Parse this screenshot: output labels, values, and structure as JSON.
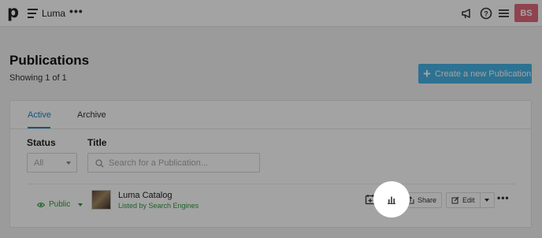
{
  "topbar": {
    "logo": "p",
    "app_name": "Luma",
    "more": "•••",
    "avatar_initials": "BS",
    "avatar_color": "#e06a7a"
  },
  "header": {
    "title": "Publications",
    "showing": "Showing 1 of 1",
    "create_button": "Create a new Publication",
    "create_button_icon": "+",
    "accent_color": "#47b2e4"
  },
  "tabs": [
    {
      "label": "Active",
      "selected": true
    },
    {
      "label": "Archive",
      "selected": false
    }
  ],
  "filters": {
    "status_label": "Status",
    "status_value": "All",
    "title_label": "Title",
    "search_placeholder": "Search for a Publication..."
  },
  "publication": {
    "visibility": "Public",
    "name": "Luma Catalog",
    "listing": "Listed by Search Engines",
    "actions": {
      "share": "Share",
      "edit": "Edit",
      "more": "•••"
    },
    "icons": [
      "calendar-plus-icon",
      "bar-chart-icon",
      "share-icon",
      "edit-icon"
    ]
  }
}
